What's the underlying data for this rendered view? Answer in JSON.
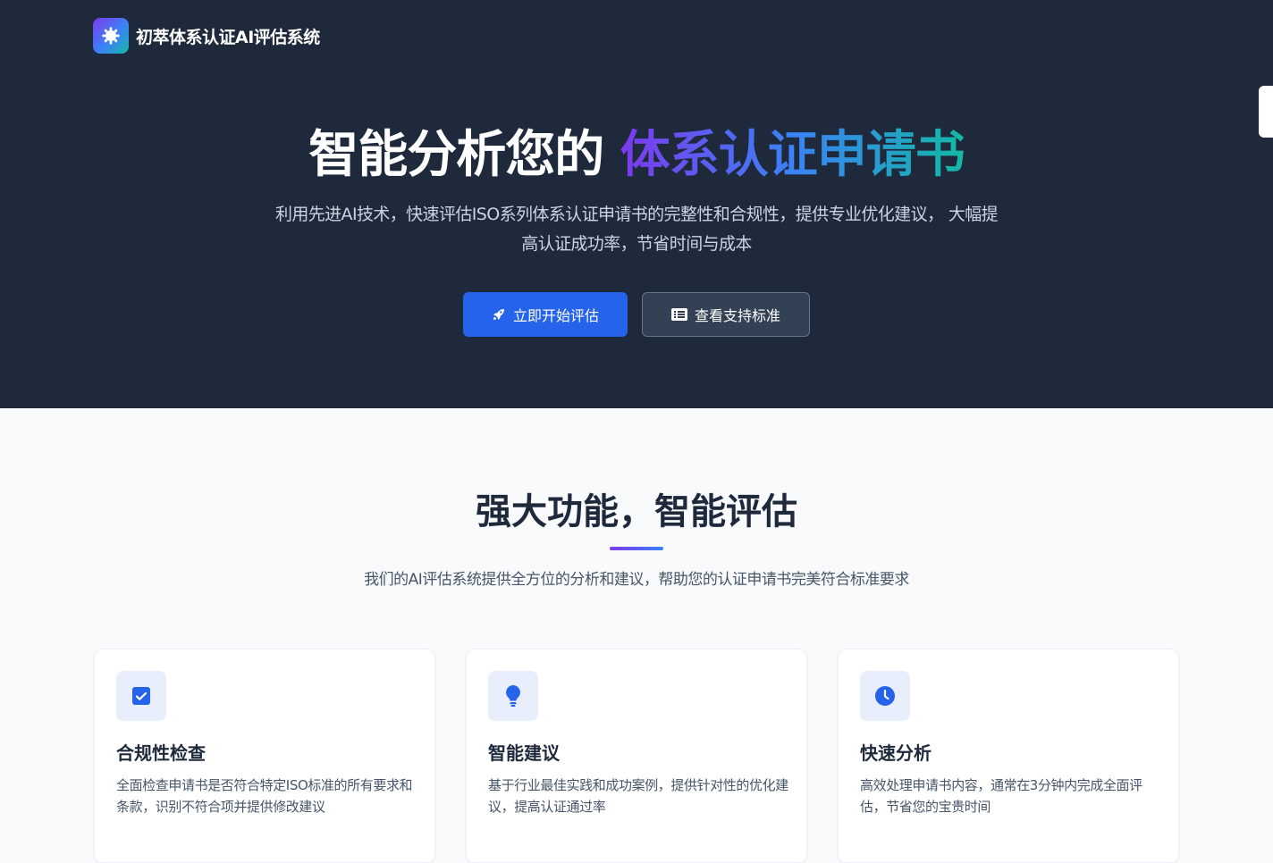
{
  "brand": {
    "title": "初萃体系认证AI评估系统",
    "logo_icon": "gear-icon"
  },
  "hero": {
    "title_plain": "智能分析您的 ",
    "title_highlight": "体系认证申请书",
    "description_line1": "利用先进AI技术，快速评估ISO系列体系认证申请书的完整性和合规性，提供专业优化建议， 大幅提",
    "description_line2": "高认证成功率，节省时间与成本",
    "primary_button": {
      "label": "立即开始评估",
      "icon": "rocket-icon"
    },
    "secondary_button": {
      "label": "查看支持标准",
      "icon": "list-icon"
    }
  },
  "features": {
    "title": "强大功能，智能评估",
    "subtitle": "我们的AI评估系统提供全方位的分析和建议，帮助您的认证申请书完美符合标准要求",
    "cards": [
      {
        "icon": "checkbox-icon",
        "title": "合规性检查",
        "desc": "全面检查申请书是否符合特定ISO标准的所有要求和条款，识别不符合项并提供修改建议"
      },
      {
        "icon": "lightbulb-icon",
        "title": "智能建议",
        "desc": "基于行业最佳实践和成功案例，提供针对性的优化建议，提高认证通过率"
      },
      {
        "icon": "clock-icon",
        "title": "快速分析",
        "desc": "高效处理申请书内容，通常在3分钟内完成全面评估，节省您的宝贵时间"
      }
    ]
  },
  "colors": {
    "hero_bg": "#1e293b",
    "primary": "#2563eb",
    "gradient_start": "#7c3aed",
    "gradient_end": "#14b8a6"
  }
}
